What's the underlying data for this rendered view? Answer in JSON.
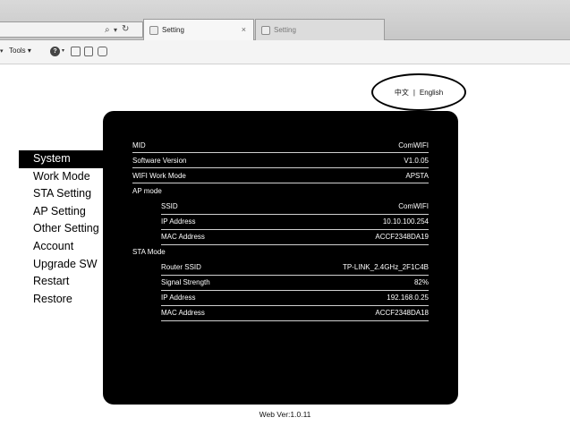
{
  "browser": {
    "tabs": [
      {
        "label": "Setting",
        "active": true
      },
      {
        "label": "Setting",
        "active": false
      }
    ],
    "tab_close_glyph": "×",
    "nav_glyphs": {
      "search": "⌕",
      "dropdown": "▾",
      "refresh": "↻"
    },
    "menu": {
      "tools_label": "Tools ▾",
      "left_arrow": "▾",
      "help_glyph": "?",
      "help_arrow": "▾"
    },
    "toolbar_icons": [
      "help-icon",
      "feedback-icon",
      "rss-icon",
      "settings-icon"
    ]
  },
  "language": {
    "zh": "中文",
    "separator": "|",
    "en": "English"
  },
  "sidebar": {
    "items": [
      {
        "label": "System",
        "active": true
      },
      {
        "label": "Work Mode",
        "active": false
      },
      {
        "label": "STA Setting",
        "active": false
      },
      {
        "label": "AP Setting",
        "active": false
      },
      {
        "label": "Other Setting",
        "active": false
      },
      {
        "label": "Account",
        "active": false
      },
      {
        "label": "Upgrade SW",
        "active": false
      },
      {
        "label": "Restart",
        "active": false
      },
      {
        "label": "Restore",
        "active": false
      }
    ]
  },
  "info": {
    "mid": {
      "label": "MID",
      "value": "ComWIFI"
    },
    "software_version": {
      "label": "Software Version",
      "value": "V1.0.05"
    },
    "wifi_work_mode": {
      "label": "WIFI Work Mode",
      "value": "APSTA"
    },
    "ap_mode": {
      "title": "AP mode",
      "ssid": {
        "label": "SSID",
        "value": "ComWIFI"
      },
      "ip_address": {
        "label": "IP Address",
        "value": "10.10.100.254"
      },
      "mac_address": {
        "label": "MAC Address",
        "value": "ACCF2348DA19"
      }
    },
    "sta_mode": {
      "title": "STA Mode",
      "router_ssid": {
        "label": "Router SSID",
        "value": "TP-LINK_2.4GHz_2F1C4B"
      },
      "signal_strength": {
        "label": "Signal Strength",
        "value": "82%"
      },
      "ip_address": {
        "label": "IP Address",
        "value": "192.168.0.25"
      },
      "mac_address": {
        "label": "MAC Address",
        "value": "ACCF2348DA18"
      }
    }
  },
  "footer": {
    "web_version": "Web Ver:1.0.11"
  },
  "colors": {
    "panel_bg": "#000000",
    "panel_text": "#ffffff",
    "active_item_bg": "#000000"
  }
}
